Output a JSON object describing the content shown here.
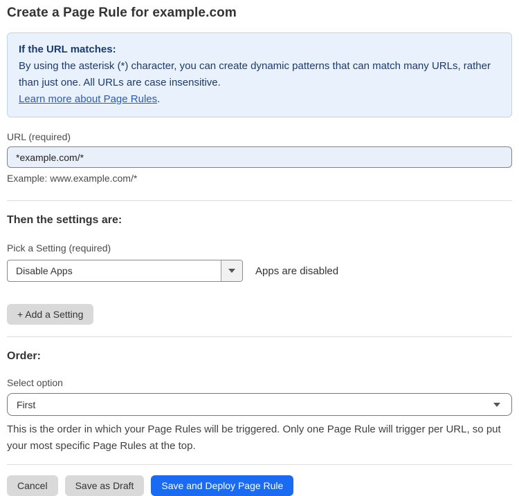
{
  "page": {
    "title": "Create a Page Rule for example.com"
  },
  "info_box": {
    "heading": "If the URL matches:",
    "body": "By using the asterisk (*) character, you can create dynamic patterns that can match many URLs, rather than just one. All URLs are case insensitive.",
    "link_text": "Learn more about Page Rules",
    "link_suffix": "."
  },
  "url_field": {
    "label": "URL (required)",
    "value": "*example.com/*",
    "helper": "Example: www.example.com/*"
  },
  "settings_section": {
    "heading": "Then the settings are:",
    "picker_label": "Pick a Setting (required)",
    "picker_value": "Disable Apps",
    "picker_status": "Apps are disabled",
    "add_setting_label": "+ Add a Setting"
  },
  "order_section": {
    "heading": "Order:",
    "select_label": "Select option",
    "select_value": "First",
    "helper": "This is the order in which your Page Rules will be triggered. Only one Page Rule will trigger per URL, so put your most specific Page Rules at the top."
  },
  "footer": {
    "cancel_label": "Cancel",
    "save_draft_label": "Save as Draft",
    "save_deploy_label": "Save and Deploy Page Rule"
  },
  "colors": {
    "accent_blue": "#1a6bf2",
    "info_bg": "#e8f1fc",
    "info_border": "#b9d7f3",
    "info_text": "#1b3a6e",
    "link_blue": "#2b5bb7",
    "input_bg": "#e9f0fa"
  }
}
